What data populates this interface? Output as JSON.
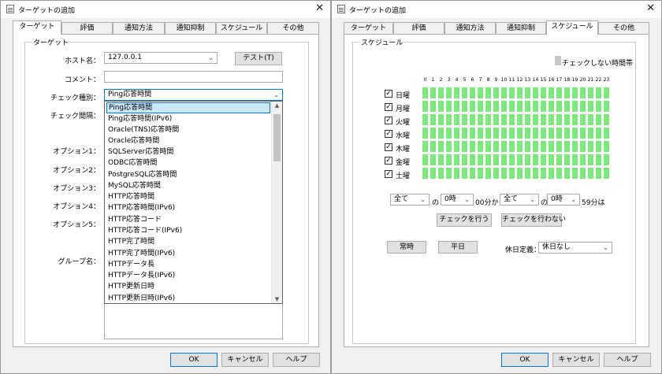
{
  "left": {
    "title": "ターゲットの追加",
    "tabs": [
      "ターゲット",
      "評価",
      "通知方法",
      "通知抑制",
      "スケジュール",
      "その他"
    ],
    "group_title": "ターゲット",
    "labels": {
      "host": "ホスト名：",
      "comment": "コメント：",
      "check_type": "チェック種別：",
      "check_interval": "チェック間隔：",
      "opt1": "オプション1：",
      "opt2": "オプション2：",
      "opt3": "オプション3：",
      "opt4": "オプション4：",
      "opt5": "オプション5：",
      "group": "グループ名："
    },
    "host_value": "127.0.0.1",
    "comment_value": "",
    "test_button": "テスト(T)",
    "check_type_value": "Ping応答時間",
    "dropdown_items": [
      "Ping応答時間",
      "Ping応答時間(IPv6)",
      "Oracle(TNS)応答時間",
      "Oracle応答時間",
      "SQLServer応答時間",
      "ODBC応答時間",
      "PostgreSQL応答時間",
      "MySQL応答時間",
      "HTTP応答時間",
      "HTTP応答時間(IPv6)",
      "HTTP応答コード",
      "HTTP応答コード(IPv6)",
      "HTTP完了時間",
      "HTTP完了時間(IPv6)",
      "HTTPデータ長",
      "HTTPデータ長(IPv6)",
      "HTTP更新日時",
      "HTTP更新日時(IPv6)"
    ],
    "buttons": {
      "ok": "OK",
      "cancel": "キャンセル",
      "help": "ヘルプ"
    }
  },
  "right": {
    "title": "ターゲットの追加",
    "tabs": [
      "ターゲット",
      "評価",
      "通知方法",
      "通知抑制",
      "スケジュール",
      "その他"
    ],
    "group_title": "スケジュール",
    "legend_label": "チェックしない時間帯",
    "hours": [
      "0",
      "1",
      "2",
      "3",
      "4",
      "5",
      "6",
      "7",
      "8",
      "9",
      "10",
      "11",
      "12",
      "13",
      "14",
      "15",
      "16",
      "17",
      "18",
      "19",
      "20",
      "21",
      "22",
      "23"
    ],
    "days": [
      {
        "label": "日曜",
        "checked": true
      },
      {
        "label": "月曜",
        "checked": true
      },
      {
        "label": "火曜",
        "checked": true
      },
      {
        "label": "水曜",
        "checked": true
      },
      {
        "label": "木曜",
        "checked": true
      },
      {
        "label": "金曜",
        "checked": true
      },
      {
        "label": "土曜",
        "checked": true
      }
    ],
    "range": {
      "from_day": "全て",
      "no1": "の",
      "from_hour": "0時",
      "from_min_text": "00分から",
      "to_day": "全て",
      "no2": "の",
      "to_hour": "0時",
      "to_min_text": "59分は"
    },
    "check_do": "チェックを行う",
    "check_dont": "チェックを行わない",
    "always": "常時",
    "weekday": "平日",
    "holiday_label": "休日定義：",
    "holiday_value": "休日なし",
    "buttons": {
      "ok": "OK",
      "cancel": "キャンセル",
      "help": "ヘルプ"
    },
    "colors": {
      "enabled_cell": "#7de87d",
      "disabled_legend": "#c8c8c8"
    }
  }
}
